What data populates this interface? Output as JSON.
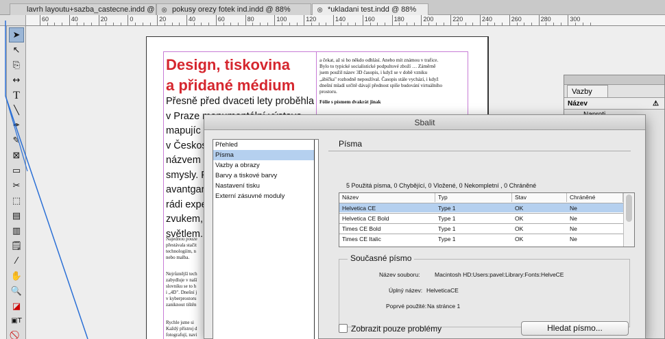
{
  "tabs": [
    {
      "label": "lavrh layoutu+sazba_castecne.indd @ 191%"
    },
    {
      "label": "pokusy orezy fotek ind.indd @ 88%"
    },
    {
      "label": "*ukladani test.indd @ 88%"
    }
  ],
  "ruler": {
    "labels": [
      "60",
      "40",
      "20",
      "0",
      "20",
      "40",
      "60",
      "80",
      "100",
      "120",
      "140",
      "160",
      "180",
      "200",
      "220",
      "240",
      "260",
      "280",
      "300"
    ]
  },
  "document": {
    "headline_line1": "Design, tiskovina",
    "headline_line2": "a přidané médium",
    "lead_lines": [
      "Přesně před dvaceti lety proběhla",
      "v Praze monumentální výstava",
      "mapujíc",
      "v Českos",
      "názvem",
      "smysly. F",
      "avantgar",
      "rádi expe",
      "zvukem,",
      "světlem."
    ],
    "small_block1": [
      "Najednou pouze",
      "přestávala stačit",
      "technologiím, n",
      "nebo malba."
    ],
    "small_block2": [
      "Nejrůznější tech",
      "zabydluje v naší",
      "slovníku se to h",
      "i „4D\". Dnešní j",
      "v kyberprostoru",
      "zaniknout tištěn"
    ],
    "small_block3": [
      "Rychle jsme si",
      "Každý přístroj d",
      "fotografují, navi"
    ],
    "right_col": [
      "a čekat, až si ho někdo odhlásí. Anebo mít známou v trafice.",
      "Bylo to typické socialistické podpultové zboží … Záměrně",
      "jsem použil název 3D časopis, i když se v době vzniku",
      "„ábíčka\" rozhodně nepoužíval. Časopis stále vychází, i když",
      "dnešní mladí určitě dávají přednost spíše budování virtuálního",
      "prostoru."
    ],
    "right_col2": [
      "Fólie s písmem dvakrát jinak"
    ]
  },
  "links_panel": {
    "tab": "Vazby",
    "col_name": "Název",
    "row1": "Naproti lm...piexx.jpg"
  },
  "dialog": {
    "title": "Sbalit",
    "sidebar": [
      {
        "label": "Přehled",
        "selected": false
      },
      {
        "label": "Písma",
        "selected": true
      },
      {
        "label": "Vazby a obrazy",
        "selected": false
      },
      {
        "label": "Barvy a tiskové barvy",
        "selected": false
      },
      {
        "label": "Nastavení tisku",
        "selected": false
      },
      {
        "label": "Externí zásuvné moduly",
        "selected": false
      }
    ],
    "section_title": "Písma",
    "summary": "5 Použitá písma, 0 Chybějící, 0 Vložené, 0 Nekompletní , 0 Chráněné",
    "columns": [
      "Název",
      "Typ",
      "Stav",
      "Chráněné"
    ],
    "rows": [
      {
        "name": "Helvetica CE",
        "type": "Type 1",
        "status": "OK",
        "protected": "Ne",
        "selected": true
      },
      {
        "name": "Helvetica CE Bold",
        "type": "Type 1",
        "status": "OK",
        "protected": "Ne",
        "selected": false
      },
      {
        "name": "Times CE Bold",
        "type": "Type 1",
        "status": "OK",
        "protected": "Ne",
        "selected": false
      },
      {
        "name": "Times CE Italic",
        "type": "Type 1",
        "status": "OK",
        "protected": "Ne",
        "selected": false
      }
    ],
    "current_font_title": "Současné písmo",
    "file_name_label": "Název souboru:",
    "file_name_value": "Macintosh HD:Users:pavel:Library:Fonts:HelveCE",
    "full_name_label": "Úplný název:",
    "full_name_value": "HelveticaCE",
    "first_used_label": "Poprvé použité:",
    "first_used_value": "Na stránce 1",
    "show_problems_label": "Zobrazit pouze problémy",
    "find_font_button": "Hledat písmo..."
  },
  "colors": {
    "headline": "#d5262e",
    "selection": "#b5d0ef",
    "guide": "#c77bd6"
  }
}
